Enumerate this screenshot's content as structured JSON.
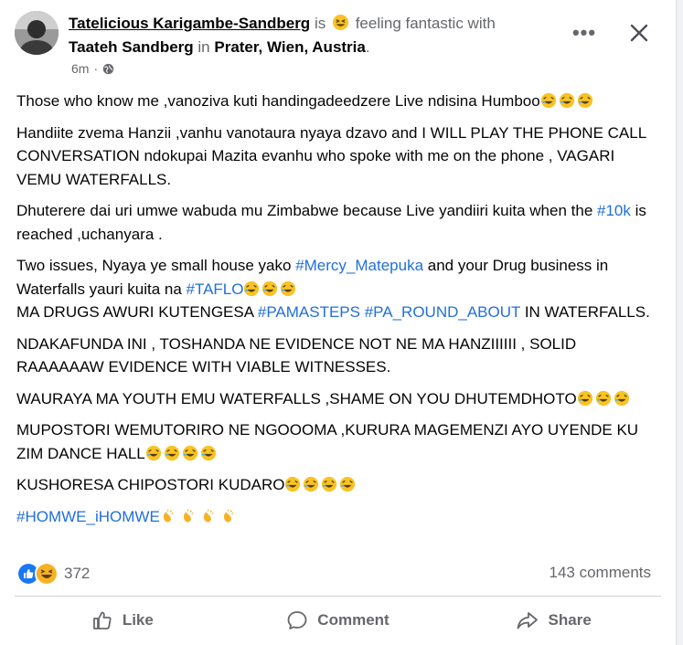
{
  "header": {
    "author": "Tatelicious Karigambe-Sandberg",
    "is_text": "is",
    "feeling_text": "feeling fantastic with",
    "tagged_person": "Taateh Sandberg",
    "in_text": "in",
    "location": "Prater, Wien, Austria",
    "period": ".",
    "time": "6m",
    "dot": "·",
    "audience_icon": "globe-icon",
    "more_label": "•••",
    "close_icon": "close-icon"
  },
  "body": {
    "p1": "Those who know me  ,vanoziva kuti handingadeedzere Live ndisina Humboo",
    "p2": "Handiite zvema Hanzii ,vanhu vanotaura nyaya dzavo and I WILL PLAY THE PHONE CALL CONVERSATION ndokupai Mazita evanhu who spoke with me on the phone , VAGARI VEMU WATERFALLS.",
    "p3_a": "Dhuterere dai uri umwe wabuda mu Zimbabwe because Live yandiiri kuita when the ",
    "p3_tag": "#10k",
    "p3_b": " is reached ,uchanyara  .",
    "p4_a": "Two issues,  Nyaya ye small house yako ",
    "p4_tag1": "#Mercy_Matepuka",
    "p4_b": " and your Drug business in Waterfalls yauri kuita na ",
    "p4_tag2": "#TAFLO",
    "p4_c": "MA DRUGS AWURI KUTENGESA ",
    "p4_tag3": "#PAMASTEPS",
    "p4_space": " ",
    "p4_tag4": "#PA_ROUND_ABOUT",
    "p4_d": " IN WATERFALLS.",
    "p5": "NDAKAFUNDA INI , TOSHANDA NE EVIDENCE NOT NE MA HANZIIIIII , SOLID RAAAAAAW EVIDENCE WITH VIABLE WITNESSES.",
    "p6": "WAURAYA MA YOUTH EMU WATERFALLS ,SHAME ON YOU DHUTEMDHOTO",
    "p7": "MUPOSTORI WEMUTORIRO NE NGOOOMA ,KURURA MAGEMENZI AYO UYENDE KU ZIM DANCE HALL",
    "p8": "KUSHORESA CHIPOSTORI KUDARO",
    "p9_tag": "#HOMWE_iHOMWE"
  },
  "footer": {
    "reaction_count": "372",
    "comments": "143 comments",
    "like_label": "Like",
    "comment_label": "Comment",
    "share_label": "Share"
  },
  "colors": {
    "link": "#216fdb",
    "text": "#050505",
    "muted": "#65676b",
    "like_blue": "#1877f2",
    "haha_yellow": "#f7b125"
  }
}
